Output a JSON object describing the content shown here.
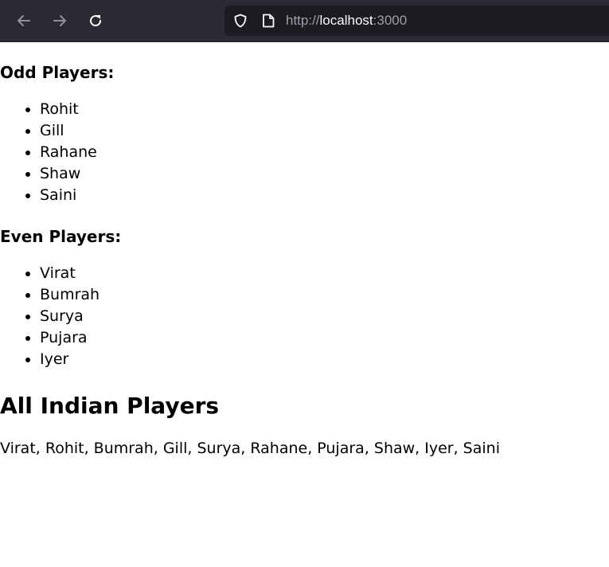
{
  "browser": {
    "url_scheme": "http://",
    "url_host": "localhost",
    "url_port": ":3000"
  },
  "odd": {
    "heading": "Odd Players:",
    "players": [
      "Rohit",
      "Gill",
      "Rahane",
      "Shaw",
      "Saini"
    ]
  },
  "even": {
    "heading": "Even Players:",
    "players": [
      "Virat",
      "Bumrah",
      "Surya",
      "Pujara",
      "Iyer"
    ]
  },
  "all": {
    "heading": "All Indian Players",
    "list_text": "Virat, Rohit, Bumrah, Gill, Surya, Rahane, Pujara, Shaw, Iyer, Saini"
  },
  "icons": {
    "back": "arrow-left-icon",
    "forward": "arrow-right-icon",
    "reload": "reload-icon",
    "shield": "shield-icon",
    "page": "page-icon"
  }
}
